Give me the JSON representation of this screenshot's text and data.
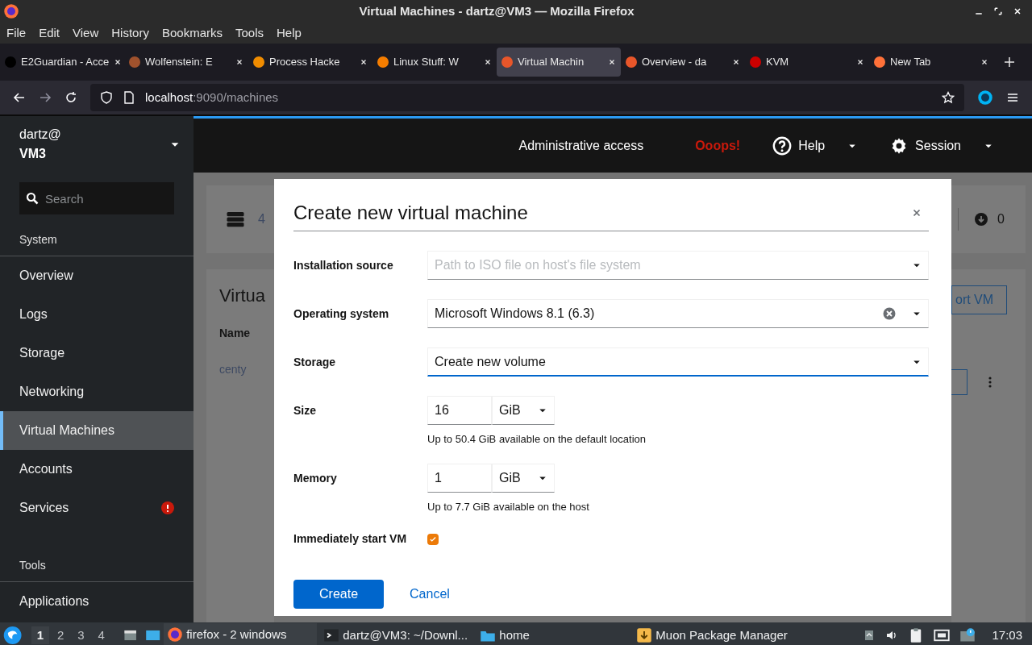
{
  "window": {
    "title": "Virtual Machines - dartz@VM3 — Mozilla Firefox"
  },
  "menu_bar": [
    "File",
    "Edit",
    "View",
    "History",
    "Bookmarks",
    "Tools",
    "Help"
  ],
  "tabs": [
    {
      "label": "E2Guardian - Acce",
      "selected": false,
      "color": "#000000"
    },
    {
      "label": "Wolfenstein: E",
      "selected": false,
      "color": "#a0522d"
    },
    {
      "label": "Process Hacke",
      "selected": false,
      "color": "#f08c00"
    },
    {
      "label": "Linux Stuff: W",
      "selected": false,
      "color": "#f57d00"
    },
    {
      "label": "Virtual Machin",
      "selected": true,
      "color": "#e8562a"
    },
    {
      "label": "Overview - da",
      "selected": false,
      "color": "#e8562a"
    },
    {
      "label": "KVM",
      "selected": false,
      "color": "#cc0000"
    },
    {
      "label": "New Tab",
      "selected": false,
      "color": "#ff7139"
    }
  ],
  "address_bar": {
    "host": "localhost",
    "path": ":9090/machines"
  },
  "sidebar": {
    "user": "dartz@",
    "host": "VM3",
    "search": {
      "placeholder": "Search"
    },
    "items": [
      {
        "kind": "heading",
        "label": "System"
      },
      {
        "kind": "item",
        "label": "Overview",
        "selected": false,
        "alert": false
      },
      {
        "kind": "item",
        "label": "Logs",
        "selected": false,
        "alert": false
      },
      {
        "kind": "item",
        "label": "Storage",
        "selected": false,
        "alert": false
      },
      {
        "kind": "item",
        "label": "Networking",
        "selected": false,
        "alert": false
      },
      {
        "kind": "item",
        "label": "Virtual Machines",
        "selected": true,
        "alert": false
      },
      {
        "kind": "item",
        "label": "Accounts",
        "selected": false,
        "alert": false
      },
      {
        "kind": "item",
        "label": "Services",
        "selected": false,
        "alert": true
      },
      {
        "kind": "heading",
        "label": "Tools"
      },
      {
        "kind": "item",
        "label": "Applications",
        "selected": false,
        "alert": false
      }
    ]
  },
  "header": {
    "access": "Administrative access",
    "warning": "Ooops!",
    "help": "Help",
    "session": "Session"
  },
  "background": {
    "count": "4",
    "heading": "Virtua",
    "column": "Name",
    "row": "centy",
    "button": "ort VM",
    "counter": "0"
  },
  "dialog": {
    "title": "Create new virtual machine",
    "fields": [
      {
        "kind": "select",
        "label": "Installation source",
        "placeholder": "Path to ISO file on host's file system",
        "clearable": false,
        "focused": false
      },
      {
        "kind": "select",
        "label": "Operating system",
        "value": "Microsoft Windows 8.1 (6.3)",
        "clearable": true,
        "focused": false
      },
      {
        "kind": "select",
        "label": "Storage",
        "value": "Create new volume",
        "clearable": false,
        "focused": true
      },
      {
        "kind": "size",
        "label": "Size",
        "value": "16",
        "unit": "GiB",
        "help": "Up to 50.4 GiB available on the default location"
      },
      {
        "kind": "size",
        "label": "Memory",
        "value": "1",
        "unit": "GiB",
        "help": "Up to 7.7 GiB available on the host"
      },
      {
        "kind": "checkbox",
        "label": "Immediately start VM",
        "checked": true
      }
    ],
    "buttons": [
      {
        "kind": "primary",
        "label": "Create"
      },
      {
        "kind": "link",
        "label": "Cancel"
      }
    ]
  },
  "taskbar": {
    "desktops": [
      {
        "label": "1",
        "selected": true
      },
      {
        "label": "2",
        "selected": false
      },
      {
        "label": "3",
        "selected": false
      },
      {
        "label": "4",
        "selected": false
      }
    ],
    "tasks": [
      {
        "label": "firefox - 2 windows",
        "selected": true,
        "kind": "firefox"
      },
      {
        "label": "dartz@VM3: ~/Downl...",
        "selected": false,
        "kind": "terminal"
      },
      {
        "label": "home",
        "selected": false,
        "kind": "folder"
      },
      {
        "label": "Muon Package Manager",
        "selected": false,
        "kind": "package"
      }
    ],
    "clock": "17:03"
  }
}
